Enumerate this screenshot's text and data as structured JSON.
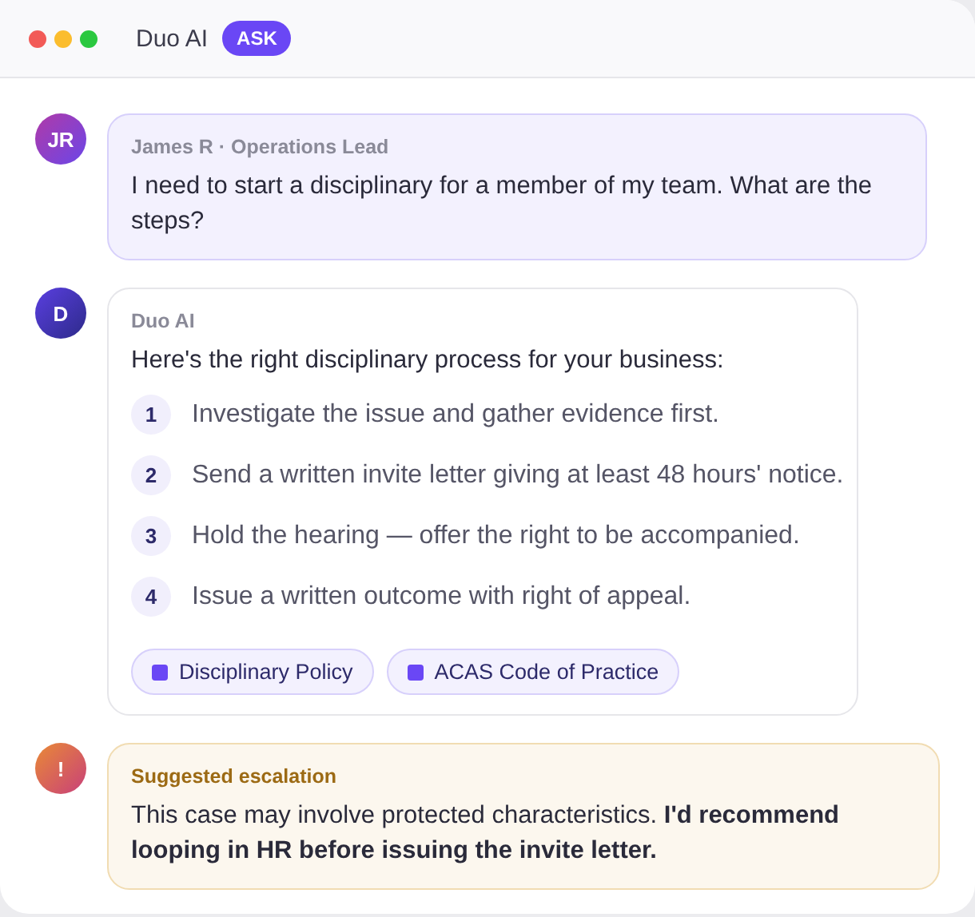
{
  "window": {
    "title": "Duo AI",
    "badge": "ASK"
  },
  "messages": [
    {
      "kind": "user",
      "avatar": "JR",
      "author": "James R · Operations Lead",
      "text": "I need to start a disciplinary for a member of my team. What are the steps?"
    },
    {
      "kind": "assistant",
      "avatar": "D",
      "author": "Duo AI",
      "text": "Here's the right disciplinary process for your business:",
      "steps": [
        {
          "number": "1",
          "text": "Investigate the issue and gather evidence first."
        },
        {
          "number": "2",
          "text": "Send a written invite letter giving at least 48 hours' notice."
        },
        {
          "number": "3",
          "text": "Hold the hearing — offer the right to be accompanied."
        },
        {
          "number": "4",
          "text": "Issue a written outcome with right of appeal."
        }
      ],
      "sources": [
        "Disciplinary Policy",
        "ACAS Code of Practice"
      ]
    },
    {
      "kind": "escalation",
      "avatar": "!",
      "author": "Suggested escalation",
      "text": "This case may involve protected characteristics. **I'd recommend looping in HR before issuing the invite letter.**"
    }
  ]
}
